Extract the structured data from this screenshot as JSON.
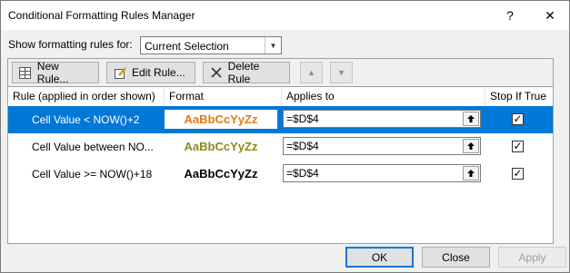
{
  "window": {
    "title": "Conditional Formatting Rules Manager",
    "help_glyph": "?",
    "close_glyph": "✕"
  },
  "show_rules": {
    "label": "Show formatting rules for:",
    "selected": "Current Selection"
  },
  "toolbar": {
    "new_rule": "New Rule...",
    "edit_rule": "Edit Rule...",
    "delete_rule": "Delete Rule",
    "move_up": "▲",
    "move_down": "▼"
  },
  "table": {
    "headers": {
      "rule": "Rule (applied in order shown)",
      "format": "Format",
      "applies_to": "Applies to",
      "stop_if_true": "Stop If True"
    },
    "rows": [
      {
        "rule": "Cell Value < NOW()+2",
        "format_preview": "AaBbCcYyZz",
        "format_color": "#e07b13",
        "format_bg": "#ffffff",
        "applies_to": "=$D$4",
        "stop_if_true": "✓"
      },
      {
        "rule": "Cell Value between NO...",
        "format_preview": "AaBbCcYyZz",
        "format_color": "#8a8a1a",
        "format_bg": "#ffffff",
        "applies_to": "=$D$4",
        "stop_if_true": "✓"
      },
      {
        "rule": "Cell Value >= NOW()+18",
        "format_preview": "AaBbCcYyZz",
        "format_color": "#000000",
        "format_bg": "#ffffff",
        "applies_to": "=$D$4",
        "stop_if_true": "✓"
      }
    ]
  },
  "buttons": {
    "ok": "OK",
    "close": "Close",
    "apply": "Apply"
  },
  "colors": {
    "selection": "#0078d7"
  }
}
